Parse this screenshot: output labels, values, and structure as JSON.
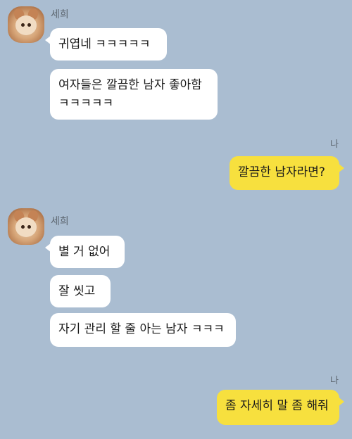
{
  "chat": {
    "groups": [
      {
        "sender": "세희",
        "messages": [
          "귀엽네 ㅋㅋㅋㅋㅋ",
          [
            "여자들은 깔끔한 남자 좋아함",
            "ㅋㅋㅋㅋㅋ"
          ]
        ]
      },
      {
        "sender": "나",
        "messages": [
          "깔끔한 남자라면?"
        ]
      },
      {
        "sender": "세희",
        "messages": [
          "별 거 없어",
          "잘 씻고",
          "자기 관리 할 줄 아는 남자 ㅋㅋㅋ"
        ]
      },
      {
        "sender": "나",
        "messages": [
          "좀 자세히 말 좀 해줘"
        ]
      }
    ]
  },
  "colors": {
    "background": "#aabdd1",
    "incoming_bubble": "#ffffff",
    "outgoing_bubble": "#f7e03e"
  },
  "icons": {
    "avatar": "hamster-avatar-icon"
  }
}
